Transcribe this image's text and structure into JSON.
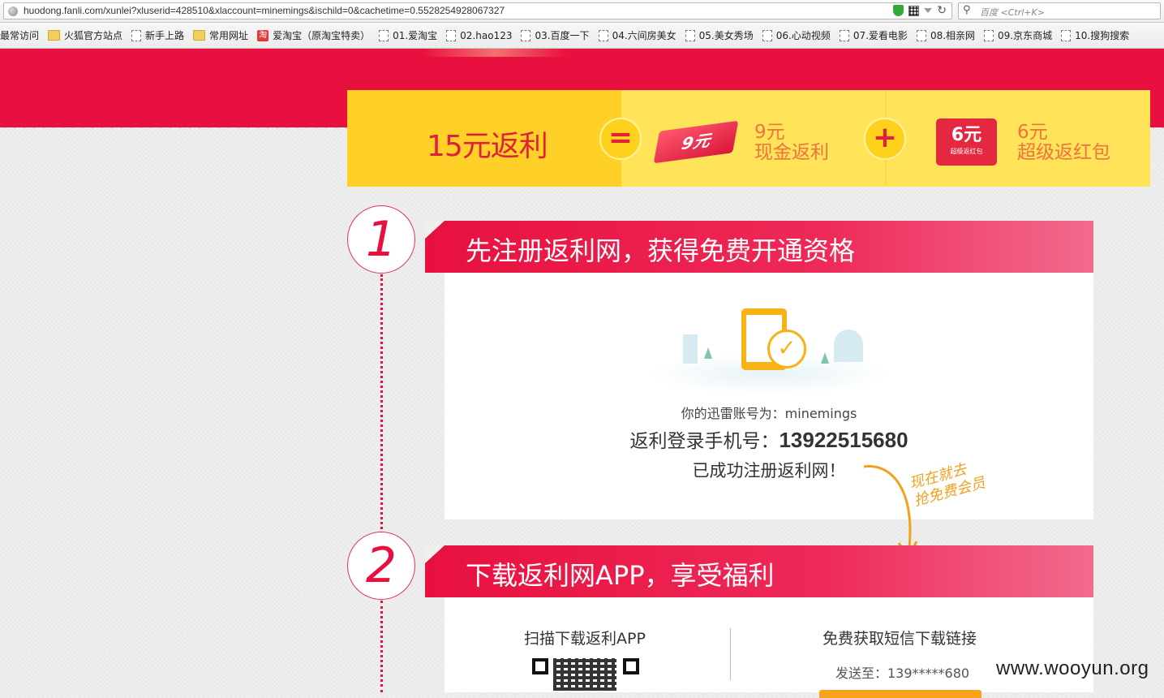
{
  "browser": {
    "url": "huodong.fanli.com/xunlei?xluserid=428510&xlaccount=minemings&ischild=0&cachetime=0.5528254928067327",
    "search_placeholder": "百度 <Ctrl+K>"
  },
  "bookmarks": [
    {
      "label": "最常访问",
      "icon": "none"
    },
    {
      "label": "火狐官方站点",
      "icon": "folder-icon"
    },
    {
      "label": "新手上路",
      "icon": "page-icon"
    },
    {
      "label": "常用网址",
      "icon": "folder-icon"
    },
    {
      "label": "爱淘宝（原淘宝特卖）",
      "icon": "taobao-icon"
    },
    {
      "label": "01.爱淘宝",
      "icon": "page-icon"
    },
    {
      "label": "02.hao123",
      "icon": "page-icon"
    },
    {
      "label": "03.百度一下",
      "icon": "page-icon"
    },
    {
      "label": "04.六间房美女",
      "icon": "page-icon"
    },
    {
      "label": "05.美女秀场",
      "icon": "page-icon"
    },
    {
      "label": "06.心动视频",
      "icon": "page-icon"
    },
    {
      "label": "07.爱看电影",
      "icon": "page-icon"
    },
    {
      "label": "08.相亲网",
      "icon": "page-icon"
    },
    {
      "label": "09.京东商城",
      "icon": "page-icon"
    },
    {
      "label": "10.搜狗搜索",
      "icon": "page-icon"
    }
  ],
  "banner": {
    "total": "15元返利",
    "equals": "=",
    "plus": "+",
    "ribbon": "9元",
    "cash_amount": "9元",
    "cash_label": "现金返利",
    "redpack_amount": "6元",
    "redpack_sub": "超级返红包",
    "bonus_amount": "6元",
    "bonus_label": "超级返红包"
  },
  "step1": {
    "number": "1",
    "title": "先注册返利网，获得免费开通资格",
    "account_label": "你的迅雷账号为：minemings",
    "phone_label": "返利登录手机号：",
    "phone": "13922515680",
    "success": "已成功注册返利网！",
    "handwriting_line1": "现在就去",
    "handwriting_line2": "抢免费会员"
  },
  "step2": {
    "number": "2",
    "title": "下载返利网APP，享受福利",
    "scan_title": "扫描下载返利APP",
    "sms_title": "免费获取短信下载链接",
    "send_to": "发送至：139*****680"
  },
  "watermark": "www.wooyun.org",
  "colors": {
    "brand_red": "#e8103f",
    "banner_yellow": "#ffe45a",
    "accent_orange": "#f0723e",
    "handwrite_orange": "#f0a11e"
  }
}
